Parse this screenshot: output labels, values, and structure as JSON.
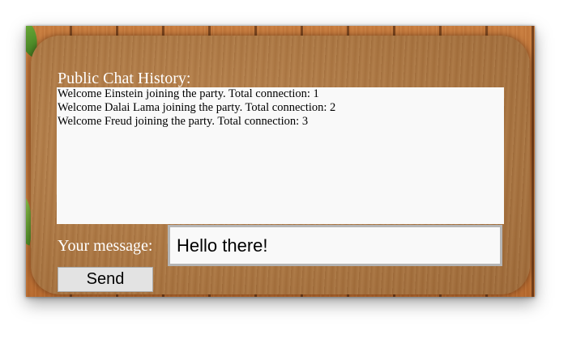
{
  "chat": {
    "history_label": "Public Chat History:",
    "history": [
      "Welcome Einstein joining the party. Total connection: 1",
      "Welcome Dalai Lama joining the party. Total connection: 2",
      "Welcome Freud joining the party. Total connection: 3"
    ],
    "message_label": "Your message:",
    "message_value": "Hello there!",
    "send_label": "Send"
  },
  "colors": {
    "label_text": "#ffffff",
    "wood": "#b07a45",
    "history_bg": "#f9f9f9"
  }
}
